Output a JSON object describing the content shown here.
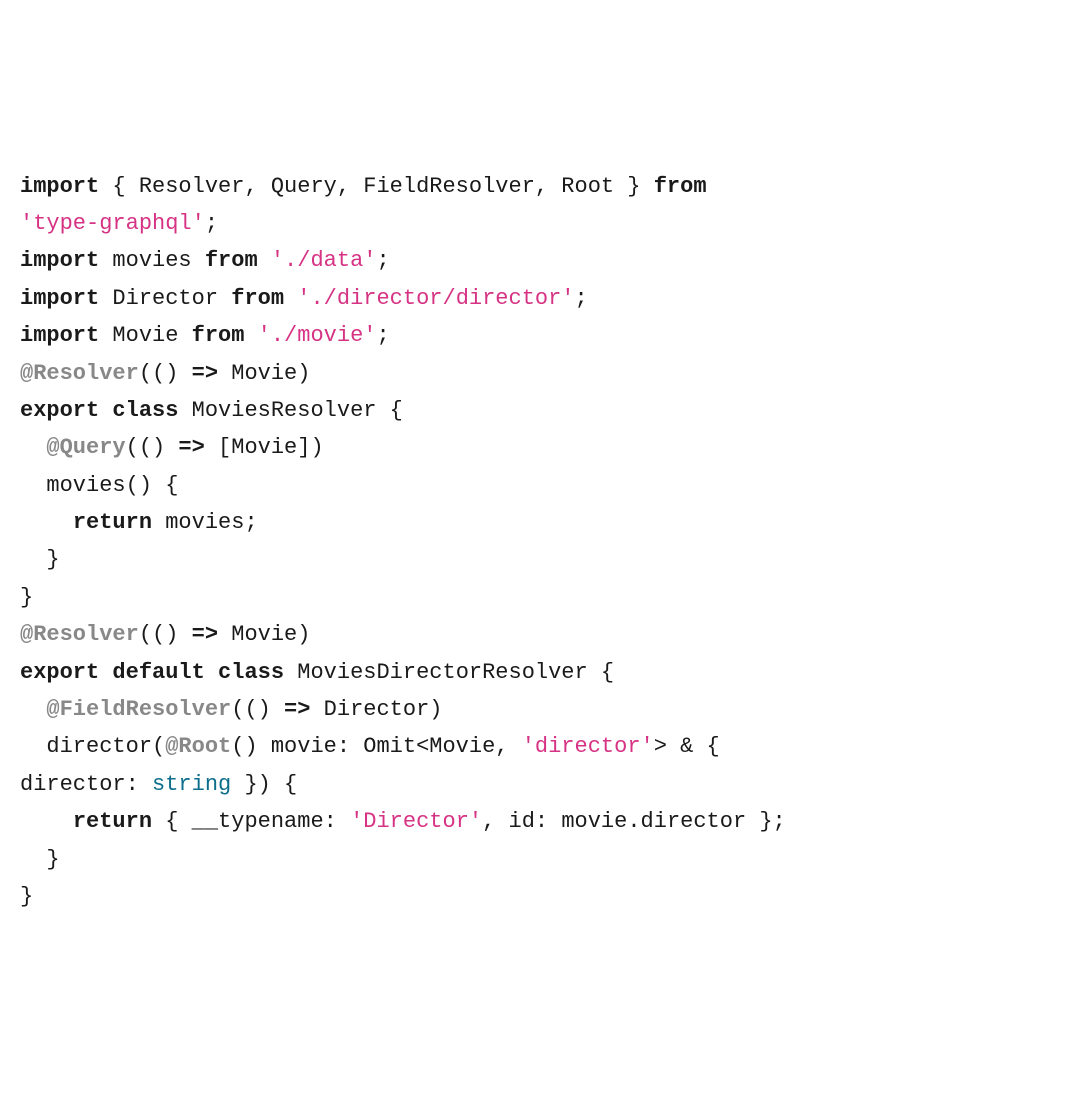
{
  "code": {
    "line1_import": "import",
    "line1_names": " { Resolver, Query, FieldResolver, Root } ",
    "line1_from": "from",
    "line1_space": " ",
    "line2_str": "'type-graphql'",
    "line2_end": ";",
    "line3_import": "import",
    "line3_names": " movies ",
    "line3_from": "from",
    "line3_space": " ",
    "line3_str": "'./data'",
    "line3_end": ";",
    "line4_import": "import",
    "line4_names": " Director ",
    "line4_from": "from",
    "line4_space": " ",
    "line4_str": "'./director/director'",
    "line4_end": ";",
    "line5_import": "import",
    "line5_names": " Movie ",
    "line5_from": "from",
    "line5_space": " ",
    "line5_str": "'./movie'",
    "line5_end": ";",
    "blank": "",
    "line7_dec": "@Resolver",
    "line7_rest": "(()",
    "line7_arrow": " => ",
    "line7_end": "Movie)",
    "line8_export": "export",
    "line8_sp1": " ",
    "line8_class": "class",
    "line8_rest": " MoviesResolver {",
    "line9_indent": "  ",
    "line9_dec": "@Query",
    "line9_rest": "(()",
    "line9_arrow": " => ",
    "line9_end": "[Movie])",
    "line10": "  movies() {",
    "line11_indent": "    ",
    "line11_return": "return",
    "line11_rest": " movies;",
    "line12": "  }",
    "line13": "}",
    "line15_dec": "@Resolver",
    "line15_rest": "(()",
    "line15_arrow": " => ",
    "line15_end": "Movie)",
    "line16_export": "export",
    "line16_sp1": " ",
    "line16_default": "default",
    "line16_sp2": " ",
    "line16_class": "class",
    "line16_rest": " MoviesDirectorResolver {",
    "line17_indent": "  ",
    "line17_dec": "@FieldResolver",
    "line17_rest": "(()",
    "line17_arrow": " => ",
    "line17_end": "Director)",
    "line18_indent": "  director(",
    "line18_dec": "@Root",
    "line18_mid": "() movie: Omit<Movie, ",
    "line18_str": "'director'",
    "line18_end": "> & { ",
    "line19_start": "director: ",
    "line19_type": "string",
    "line19_end": " }) {",
    "line20_indent": "    ",
    "line20_return": "return",
    "line20_mid": " { __typename: ",
    "line20_str": "'Director'",
    "line20_end": ", id: movie.director };",
    "line21": "  }",
    "line22": "}"
  }
}
